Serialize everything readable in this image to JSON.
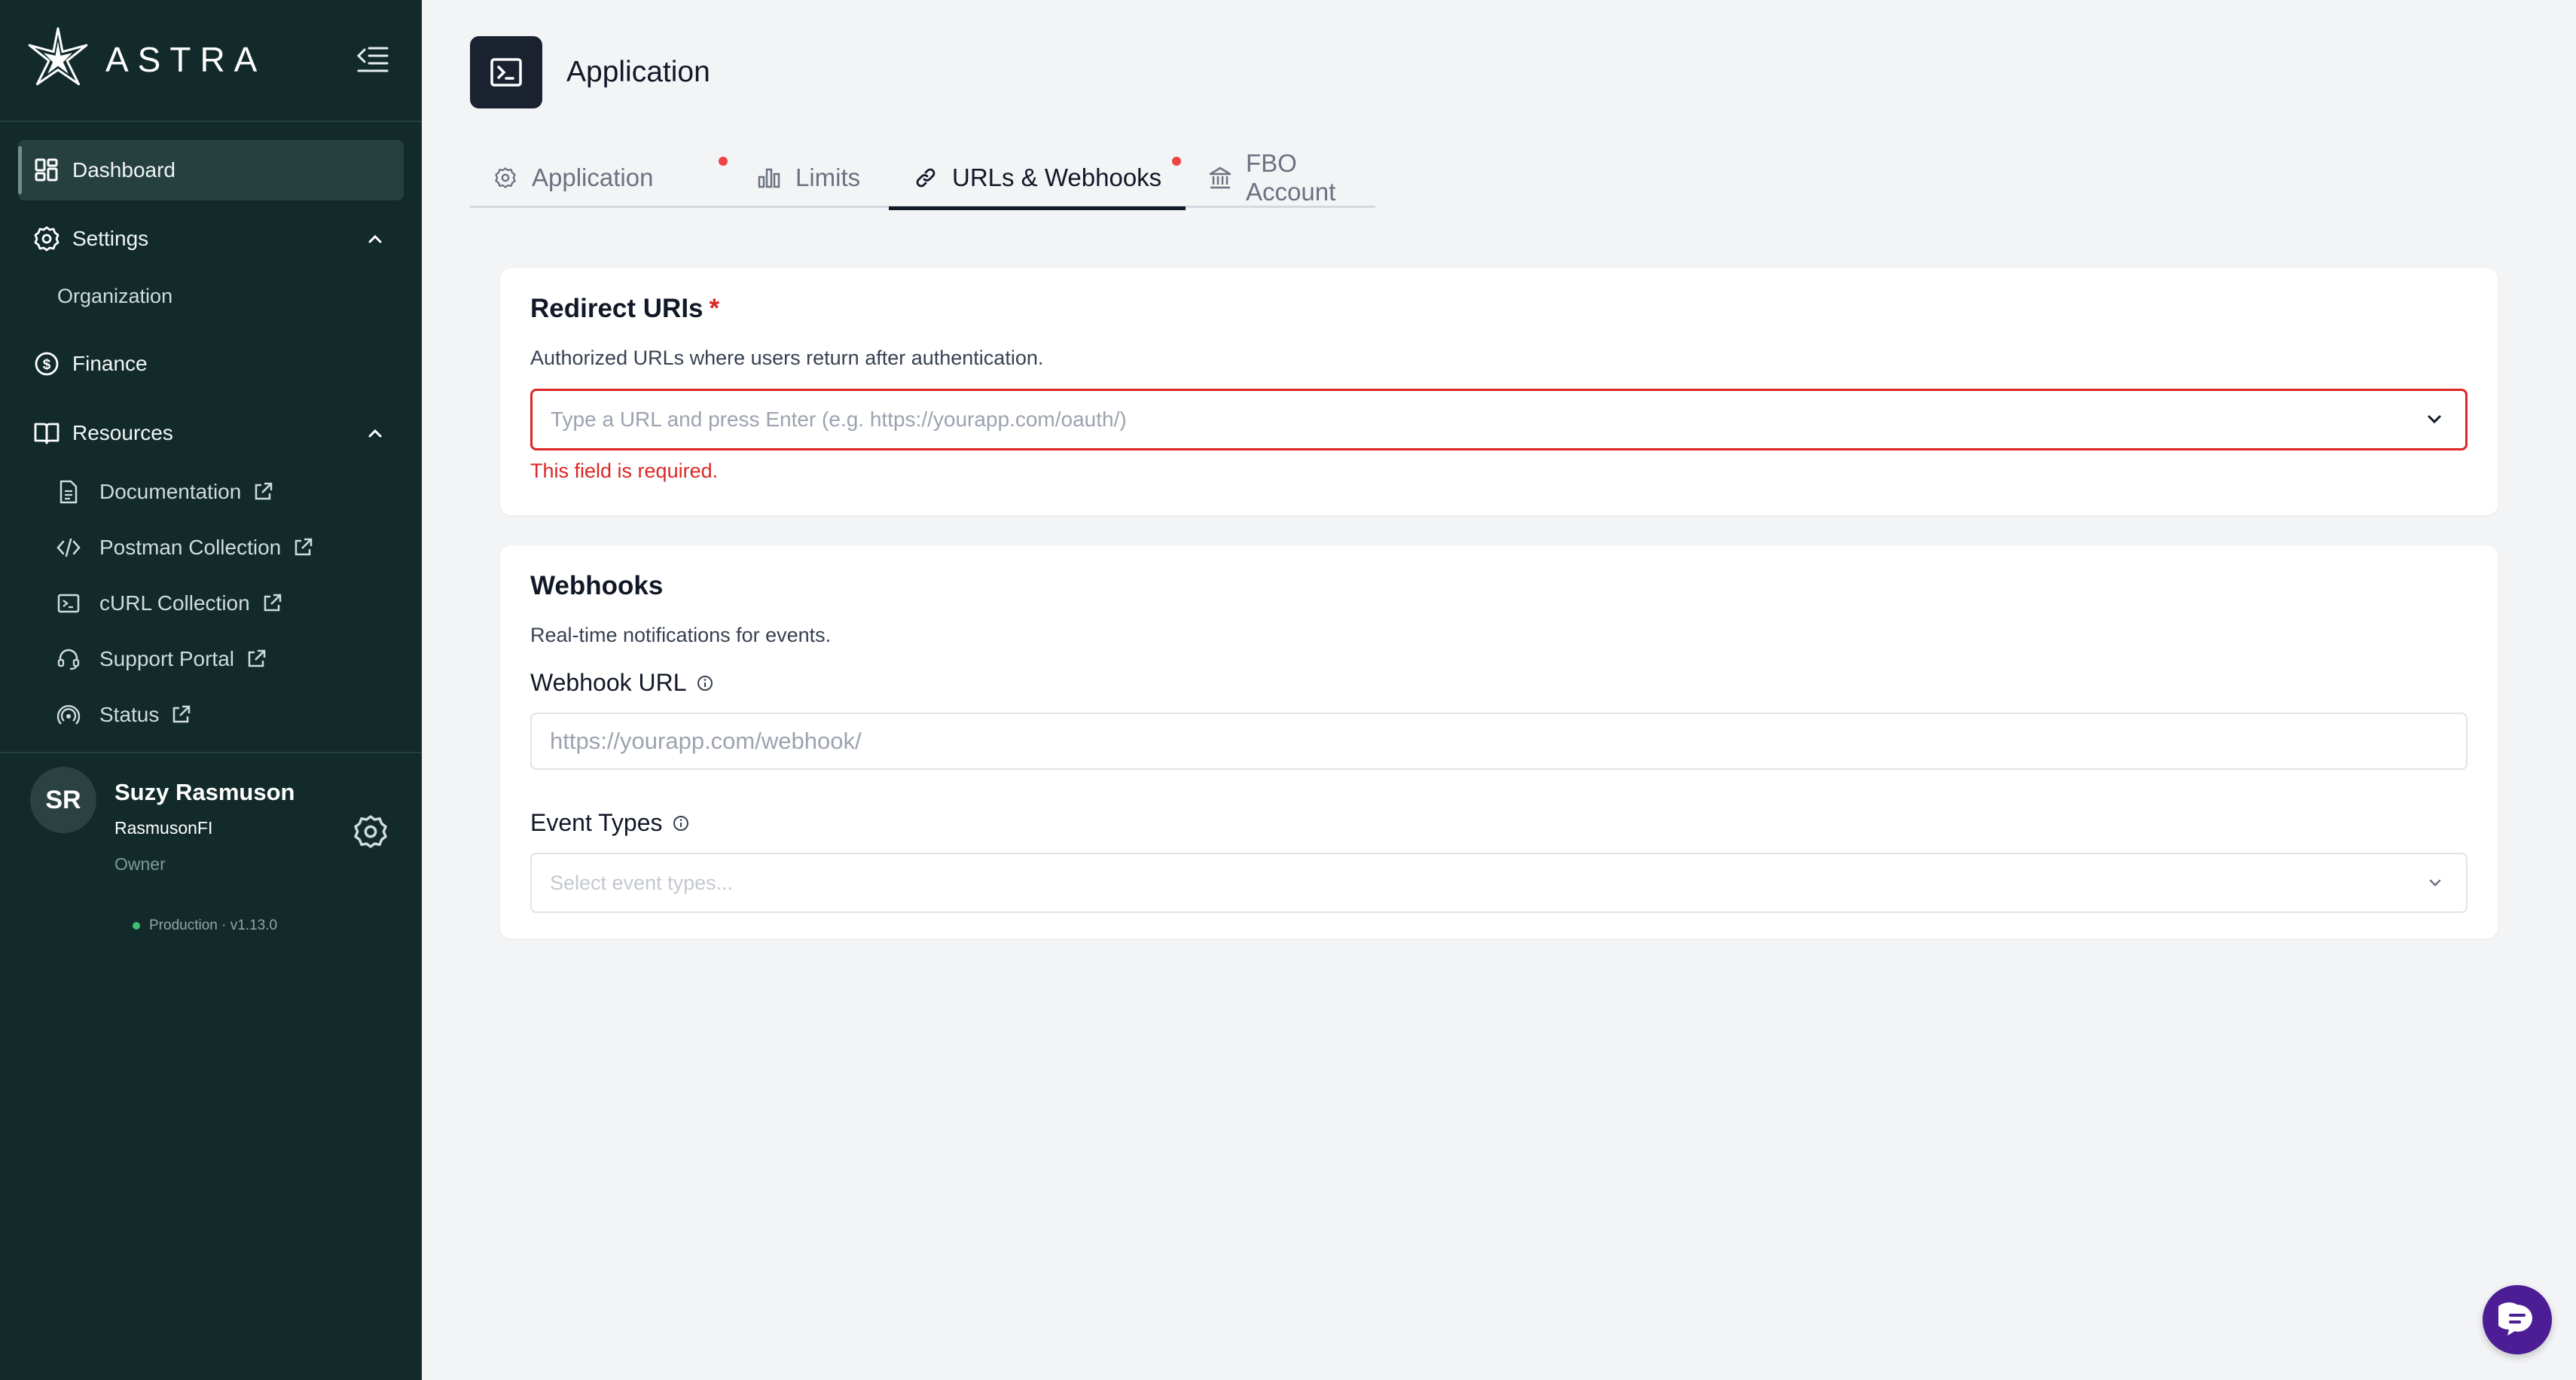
{
  "brand": {
    "name": "ASTRA"
  },
  "sidebar": {
    "dashboard": "Dashboard",
    "settings": "Settings",
    "organization": "Organization",
    "finance": "Finance",
    "resources": "Resources",
    "resource_links": [
      {
        "label": "Documentation",
        "icon": "document-icon"
      },
      {
        "label": "Postman Collection",
        "icon": "code-icon"
      },
      {
        "label": "cURL Collection",
        "icon": "terminal-icon"
      },
      {
        "label": "Support Portal",
        "icon": "headset-icon"
      },
      {
        "label": "Status",
        "icon": "signal-icon"
      }
    ]
  },
  "user": {
    "initials": "SR",
    "name": "Suzy Rasmuson",
    "org": "RasmusonFI",
    "role": "Owner",
    "environment": "Production · v1.13.0"
  },
  "header": {
    "title": "Application"
  },
  "tabs": [
    {
      "label": "Application",
      "icon": "gear-icon",
      "has_dot": true
    },
    {
      "label": "Limits",
      "icon": "bar-chart-icon",
      "has_dot": false
    },
    {
      "label": "URLs & Webhooks",
      "icon": "link-icon",
      "has_dot": true,
      "active": true
    },
    {
      "label": "FBO Account",
      "icon": "bank-icon",
      "has_dot": false
    }
  ],
  "redirect": {
    "title": "Redirect URIs",
    "required_mark": "*",
    "description": "Authorized URLs where users return after authentication.",
    "placeholder": "Type a URL and press Enter (e.g. https://yourapp.com/oauth/)",
    "error": "This field is required."
  },
  "webhooks": {
    "title": "Webhooks",
    "description": "Real-time notifications for events.",
    "url_label": "Webhook URL",
    "url_placeholder": "https://yourapp.com/webhook/",
    "event_label": "Event Types",
    "event_placeholder": "Select event types..."
  },
  "colors": {
    "sidebar_bg": "#122a2a",
    "error": "#dc2626",
    "accent_dark": "#111827",
    "chat": "#4c1d95"
  }
}
